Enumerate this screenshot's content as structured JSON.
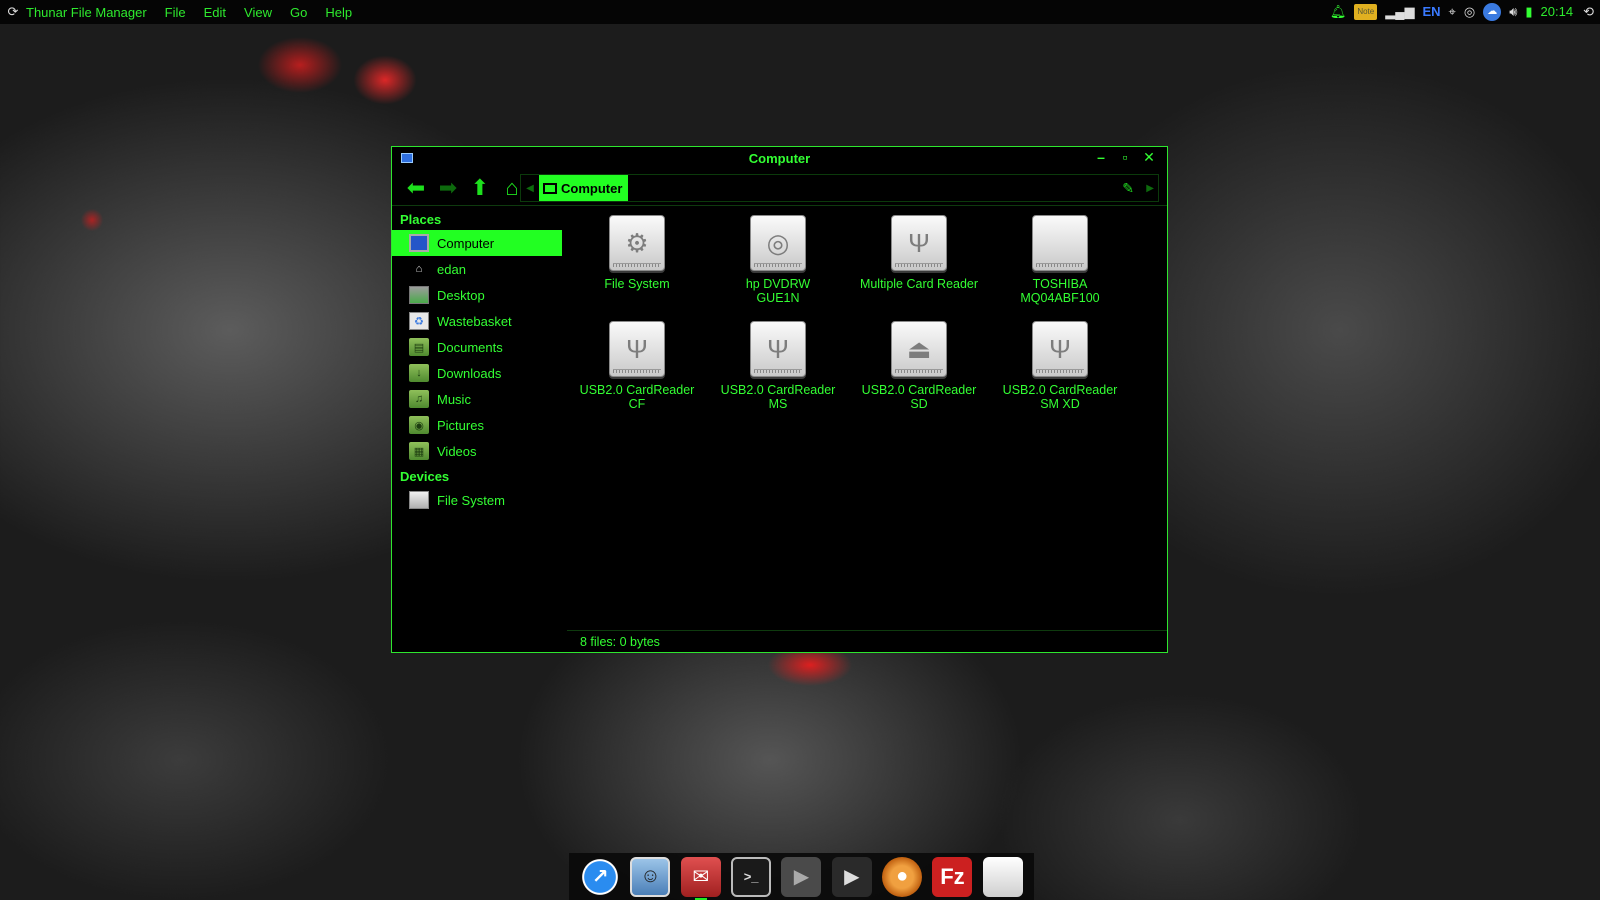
{
  "top_panel": {
    "app_title": "Thunar File Manager",
    "menu": [
      "File",
      "Edit",
      "View",
      "Go",
      "Help"
    ],
    "tray": {
      "language": "EN",
      "note_label": "Note",
      "clock": "20:14"
    }
  },
  "window": {
    "title": "Computer",
    "controls": {
      "minimize": "–",
      "maximize": "▫",
      "close": "✕"
    },
    "pathbar": {
      "current": "Computer"
    },
    "sidebar": {
      "places_heading": "Places",
      "places": [
        {
          "label": "Computer",
          "icon": "monitor-icon",
          "selected": true
        },
        {
          "label": "edan",
          "icon": "home-icon"
        },
        {
          "label": "Desktop",
          "icon": "desktop-icon"
        },
        {
          "label": "Wastebasket",
          "icon": "trash-icon"
        },
        {
          "label": "Documents",
          "icon": "documents-folder-icon"
        },
        {
          "label": "Downloads",
          "icon": "downloads-folder-icon"
        },
        {
          "label": "Music",
          "icon": "music-folder-icon"
        },
        {
          "label": "Pictures",
          "icon": "pictures-folder-icon"
        },
        {
          "label": "Videos",
          "icon": "videos-folder-icon"
        }
      ],
      "devices_heading": "Devices",
      "devices": [
        {
          "label": "File System",
          "icon": "drive-icon"
        }
      ]
    },
    "files": [
      {
        "label": "File System",
        "icon": "gear-drive-icon"
      },
      {
        "label": "hp        DVDRW\nGUE1N",
        "icon": "optical-drive-icon"
      },
      {
        "label": "Multiple Card  Reader",
        "icon": "usb-drive-icon"
      },
      {
        "label": "TOSHIBA\nMQ04ABF100",
        "icon": "hard-drive-icon"
      },
      {
        "label": "USB2.0 CardReader\nCF",
        "icon": "usb-drive-icon"
      },
      {
        "label": "USB2.0 CardReader\nMS",
        "icon": "usb-drive-icon"
      },
      {
        "label": "USB2.0 CardReader\nSD",
        "icon": "eject-drive-icon"
      },
      {
        "label": "USB2.0 CardReader\nSM XD",
        "icon": "usb-drive-icon"
      }
    ],
    "status": "8 files: 0 bytes"
  },
  "dock": {
    "items": [
      {
        "name": "browser-compass-icon"
      },
      {
        "name": "photo-frame-icon"
      },
      {
        "name": "mail-icon",
        "running": true
      },
      {
        "name": "terminal-icon"
      },
      {
        "name": "media-player-icon"
      },
      {
        "name": "video-editor-icon"
      },
      {
        "name": "disc-burner-icon"
      },
      {
        "name": "filezilla-icon",
        "text": "Fz"
      },
      {
        "name": "blank-file-icon"
      }
    ]
  },
  "colors": {
    "accent": "#33ff33",
    "selection": "#22ff22",
    "window_bg": "#000000",
    "panel_bg": "#050505"
  }
}
